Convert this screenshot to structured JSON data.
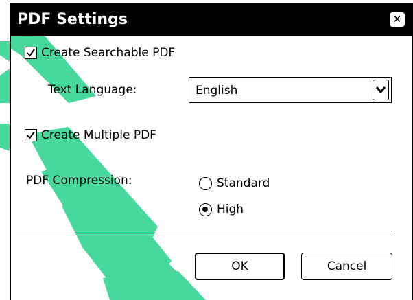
{
  "dialog": {
    "title": "PDF Settings",
    "close_icon": "close-icon"
  },
  "searchable": {
    "label": "Create Searchable PDF",
    "checked": true
  },
  "language": {
    "label": "Text Language:",
    "selected": "English"
  },
  "multiple": {
    "label": "Create Multiple PDF",
    "checked": true
  },
  "compression": {
    "label": "PDF Compression:",
    "options": [
      "Standard",
      "High"
    ],
    "selected": "High"
  },
  "buttons": {
    "ok": "OK",
    "cancel": "Cancel"
  },
  "colors": {
    "titlebar": "#000000",
    "watermark": "#26d28c"
  }
}
